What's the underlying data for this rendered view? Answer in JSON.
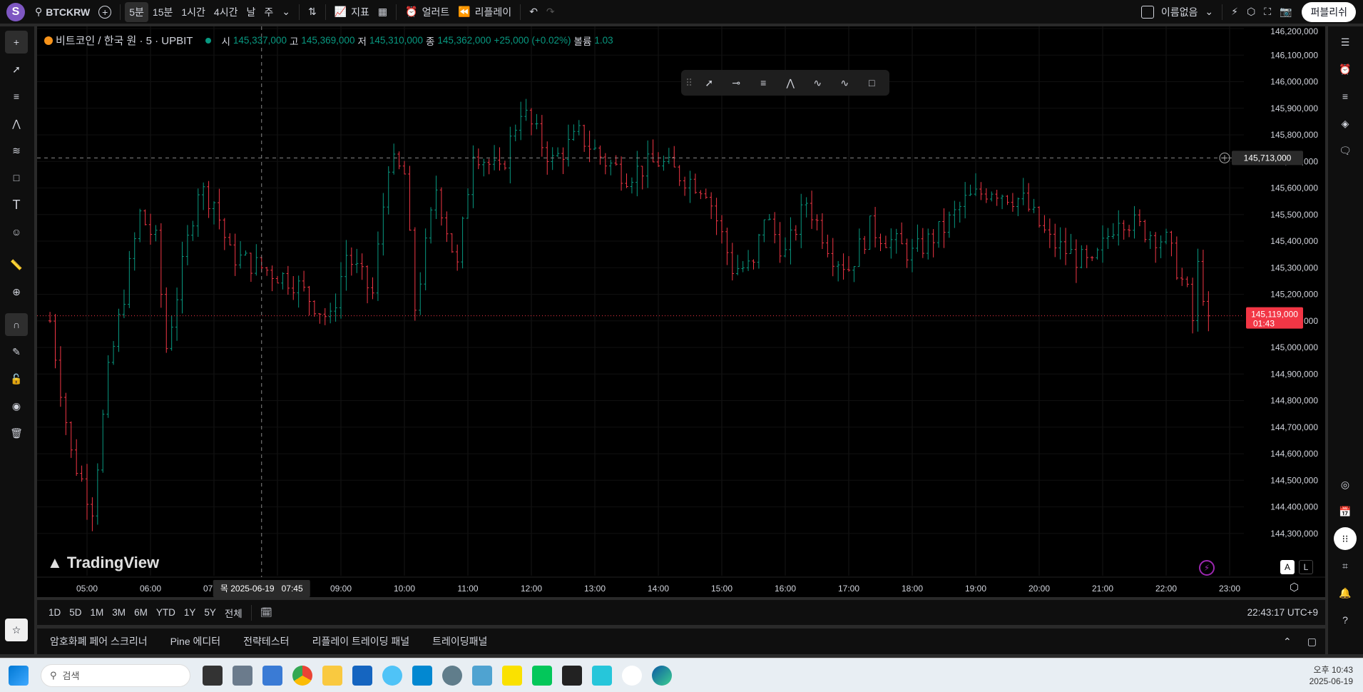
{
  "topbar": {
    "avatar": "S",
    "symbol": "BTCKRW",
    "intervals": [
      "5분",
      "15분",
      "1시간",
      "4시간",
      "날",
      "주"
    ],
    "active_interval": "5분",
    "indicators": "지표",
    "alert": "얼러트",
    "replay": "리플레이",
    "layout_name": "이름없음",
    "publish": "퍼블리쉬"
  },
  "legend": {
    "title": "비트코인 / 한국 원 · 5 · UPBIT",
    "o_label": "시",
    "o": "145,337,000",
    "h_label": "고",
    "h": "145,369,000",
    "l_label": "저",
    "l": "145,310,000",
    "c_label": "종",
    "c": "145,362,000",
    "change": "+25,000 (+0.02%)",
    "vol_label": "볼륨",
    "vol": "1.03"
  },
  "watermark": "TradingView",
  "crosshair": {
    "price": "145,713,000",
    "time": "목 2025-06-19   07:45"
  },
  "last_price": {
    "price": "145,119,000",
    "countdown": "01:43"
  },
  "price_axis": [
    "146,200,000",
    "146,100,000",
    "146,000,000",
    "145,900,000",
    "145,800,000",
    "145,700,000",
    "145,600,000",
    "145,500,000",
    "145,400,000",
    "145,300,000",
    "145,200,000",
    "145,100,000",
    "145,000,000",
    "144,900,000",
    "144,800,000",
    "144,700,000",
    "144,600,000",
    "144,500,000",
    "144,400,000",
    "144,300,000"
  ],
  "time_axis": [
    "05:00",
    "06:00",
    "07:00",
    "08:00",
    "09:00",
    "10:00",
    "11:00",
    "12:00",
    "13:00",
    "14:00",
    "15:00",
    "16:00",
    "17:00",
    "18:00",
    "19:00",
    "20:00",
    "21:00",
    "22:00",
    "23:00"
  ],
  "scale_buttons": {
    "auto": "A",
    "log": "L"
  },
  "ranges": [
    "1D",
    "5D",
    "1M",
    "3M",
    "6M",
    "YTD",
    "1Y",
    "5Y",
    "전체"
  ],
  "clock": "22:43:17 UTC+9",
  "bottom_tabs": [
    "암호화폐 페어 스크리너",
    "Pine 에디터",
    "전략테스터",
    "리플레이 트레이딩 패널",
    "트레이딩패널"
  ],
  "taskbar": {
    "search": "검색",
    "time": "오후 10:43",
    "date": "2025-06-19"
  },
  "colors": {
    "up": "#089981",
    "down": "#f23645",
    "accent": "#2962ff"
  },
  "chart_data": {
    "type": "candlestick",
    "interval_minutes": 5,
    "start": "04:25",
    "ylim": [
      144250000,
      146230000
    ],
    "anchors": [
      [
        "04:25",
        145100000
      ],
      [
        "04:45",
        144600000
      ],
      [
        "05:05",
        144400000
      ],
      [
        "05:20",
        144900000
      ],
      [
        "05:35",
        145200000
      ],
      [
        "05:50",
        145500000
      ],
      [
        "06:05",
        145400000
      ],
      [
        "06:15",
        145000000
      ],
      [
        "06:30",
        145300000
      ],
      [
        "06:45",
        145600000
      ],
      [
        "07:00",
        145550000
      ],
      [
        "07:15",
        145350000
      ],
      [
        "07:45",
        145300000
      ],
      [
        "08:15",
        145250000
      ],
      [
        "08:50",
        145100000
      ],
      [
        "09:05",
        145350000
      ],
      [
        "09:30",
        145200000
      ],
      [
        "09:45",
        145700000
      ],
      [
        "10:00",
        145650000
      ],
      [
        "10:10",
        145150000
      ],
      [
        "10:30",
        145600000
      ],
      [
        "10:50",
        145300000
      ],
      [
        "11:05",
        145750000
      ],
      [
        "11:30",
        145650000
      ],
      [
        "11:50",
        145900000
      ],
      [
        "12:20",
        145700000
      ],
      [
        "12:45",
        145800000
      ],
      [
        "13:10",
        145700000
      ],
      [
        "13:30",
        145650000
      ],
      [
        "14:00",
        145700000
      ],
      [
        "14:20",
        145650000
      ],
      [
        "14:45",
        145600000
      ],
      [
        "15:10",
        145300000
      ],
      [
        "15:30",
        145300000
      ],
      [
        "15:40",
        145500000
      ],
      [
        "16:00",
        145350000
      ],
      [
        "16:20",
        145550000
      ],
      [
        "16:45",
        145350000
      ],
      [
        "17:00",
        145300000
      ],
      [
        "17:20",
        145450000
      ],
      [
        "17:40",
        145400000
      ],
      [
        "18:00",
        145350000
      ],
      [
        "18:30",
        145450000
      ],
      [
        "18:50",
        145550000
      ],
      [
        "19:15",
        145600000
      ],
      [
        "19:45",
        145550000
      ],
      [
        "20:10",
        145400000
      ],
      [
        "20:30",
        145350000
      ],
      [
        "20:50",
        145300000
      ],
      [
        "21:15",
        145500000
      ],
      [
        "21:35",
        145450000
      ],
      [
        "22:00",
        145400000
      ],
      [
        "22:20",
        145200000
      ],
      [
        "22:25",
        145100000
      ],
      [
        "22:30",
        145300000
      ],
      [
        "22:40",
        145119000
      ]
    ]
  }
}
